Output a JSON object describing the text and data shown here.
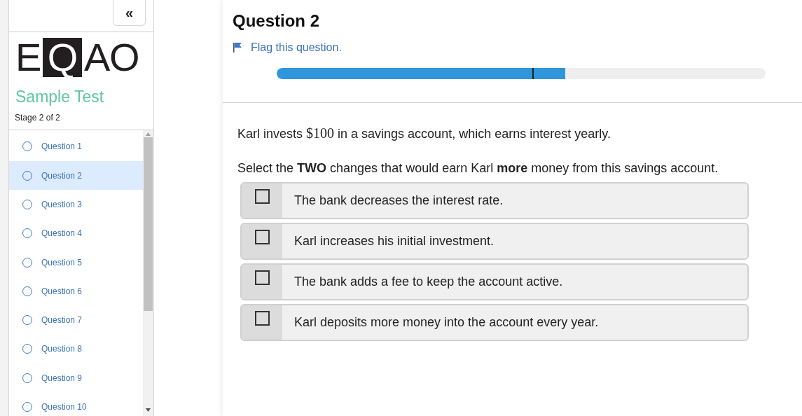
{
  "sidebar": {
    "collapse_button": "«",
    "logo": [
      {
        "text": "E",
        "kind": "plain"
      },
      {
        "text": "Q",
        "kind": "boxed"
      },
      {
        "text": "AO",
        "kind": "plain"
      }
    ],
    "title": "Sample Test",
    "stage": "Stage 2 of 2",
    "items": [
      {
        "label": "Question 1",
        "selected": false
      },
      {
        "label": "Question 2",
        "selected": true
      },
      {
        "label": "Question 3",
        "selected": false
      },
      {
        "label": "Question 4",
        "selected": false
      },
      {
        "label": "Question 5",
        "selected": false
      },
      {
        "label": "Question 6",
        "selected": false
      },
      {
        "label": "Question 7",
        "selected": false
      },
      {
        "label": "Question 8",
        "selected": false
      },
      {
        "label": "Question 9",
        "selected": false
      },
      {
        "label": "Question 10",
        "selected": false
      }
    ]
  },
  "question": {
    "title": "Question 2",
    "flag_link": "Flag this question.",
    "progress": {
      "level": 0.59,
      "marker": {
        "level": 0.523
      }
    },
    "stem": {
      "before": "Karl invests ",
      "amount": "$100",
      "after": " in a savings account, which earns interest yearly."
    },
    "instruction": "Select the **TWO** changes that would earn Karl **more** money from this savings account.",
    "options": [
      {
        "text": "The bank decreases the interest rate.",
        "checked": false
      },
      {
        "text": "Karl increases his initial investment.",
        "checked": false
      },
      {
        "text": "The bank adds a fee to keep the account active.",
        "checked": false
      },
      {
        "text": "Karl deposits more money into the account every year.",
        "checked": false
      }
    ]
  }
}
